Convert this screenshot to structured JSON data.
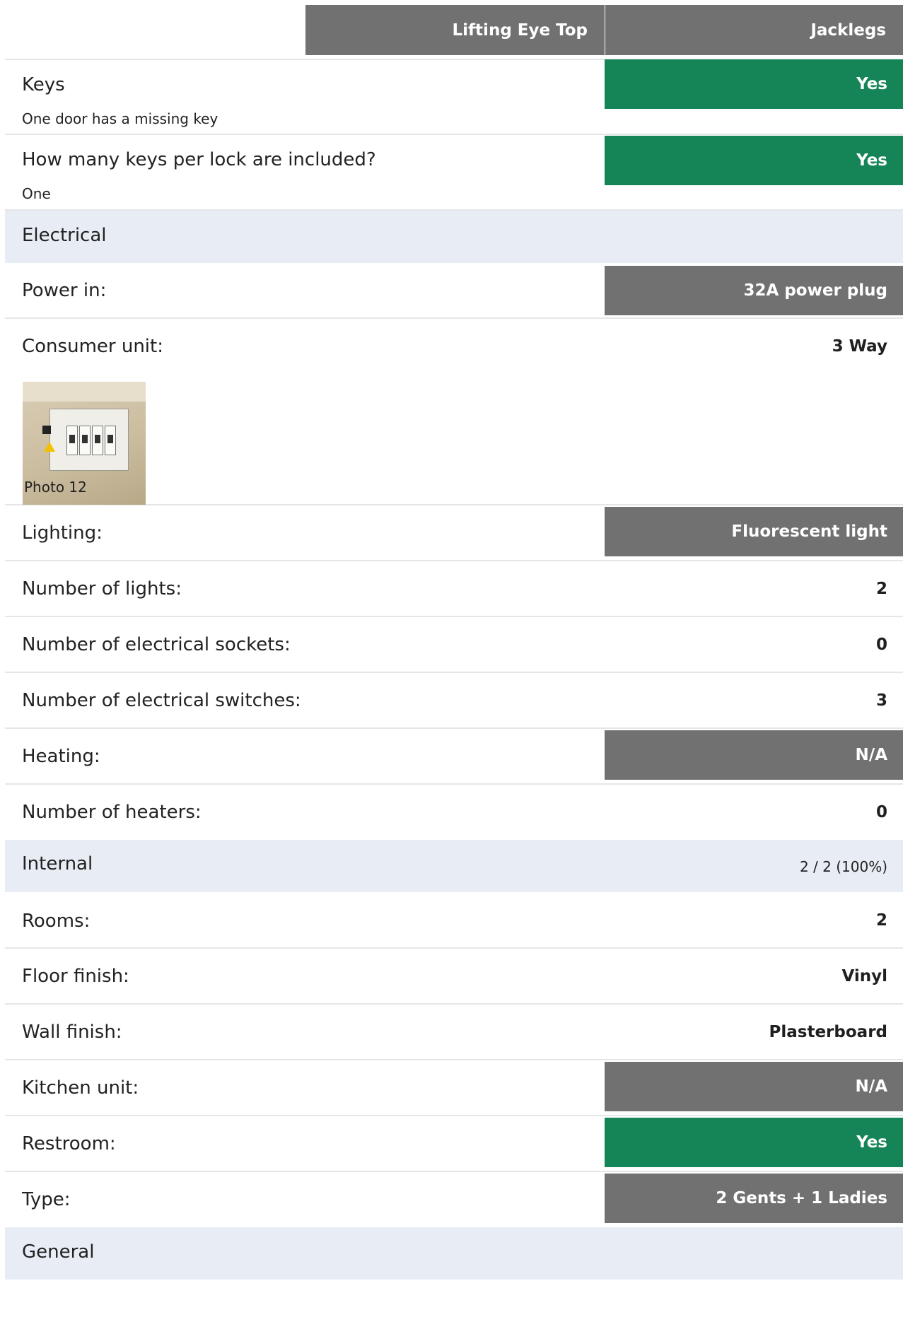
{
  "header": {
    "col_a": "Lifting Eye Top",
    "col_b": "Jacklegs"
  },
  "rows": {
    "keys": {
      "label": "Keys",
      "value": "Yes",
      "note": "One door has a missing key"
    },
    "keys_per_lock": {
      "label": "How many keys per lock are included?",
      "value": "Yes",
      "note": "One"
    },
    "electrical": {
      "label": "Electrical"
    },
    "power_in": {
      "label": "Power in:",
      "value": "32A power plug"
    },
    "consumer_unit": {
      "label": "Consumer unit:",
      "value": "3 Way",
      "photo_caption": "Photo 12"
    },
    "lighting": {
      "label": "Lighting:",
      "value": "Fluorescent light"
    },
    "num_lights": {
      "label": "Number of lights:",
      "value": "2"
    },
    "num_sockets": {
      "label": "Number of electrical sockets:",
      "value": "0"
    },
    "num_switches": {
      "label": "Number of electrical switches:",
      "value": "3"
    },
    "heating": {
      "label": "Heating:",
      "value": "N/A"
    },
    "num_heaters": {
      "label": "Number of heaters:",
      "value": "0"
    },
    "internal": {
      "label": "Internal",
      "count": "2 / 2 (100%)"
    },
    "rooms": {
      "label": "Rooms:",
      "value": "2"
    },
    "floor_finish": {
      "label": "Floor finish:",
      "value": "Vinyl"
    },
    "wall_finish": {
      "label": "Wall finish:",
      "value": "Plasterboard"
    },
    "kitchen_unit": {
      "label": "Kitchen unit:",
      "value": "N/A"
    },
    "restroom": {
      "label": "Restroom:",
      "value": "Yes"
    },
    "type": {
      "label": "Type:",
      "value": "2 Gents + 1 Ladies"
    },
    "general": {
      "label": "General"
    }
  },
  "colors": {
    "yes_green": "#158457",
    "header_grey": "#717171",
    "section_bg": "#e8edf5"
  },
  "icons": {
    "consumer_unit_photo": "photo-thumbnail"
  }
}
